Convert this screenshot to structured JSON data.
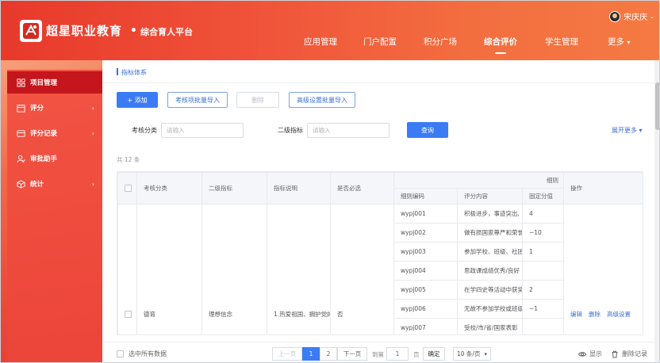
{
  "header": {
    "logo_text": "超星职业教育",
    "separator": "•",
    "platform_name": "综合育人平台",
    "user_name": "宋庆庆",
    "nav": [
      {
        "label": "应用管理",
        "active": false
      },
      {
        "label": "门户配置",
        "active": false
      },
      {
        "label": "积分广场",
        "active": false
      },
      {
        "label": "综合评价",
        "active": true
      },
      {
        "label": "学生管理",
        "active": false
      },
      {
        "label": "更多",
        "active": false
      }
    ]
  },
  "sidebar": {
    "items": [
      {
        "label": "项目管理",
        "icon": "grid-icon",
        "active": true,
        "arrow": ""
      },
      {
        "label": "评分",
        "icon": "calendar-icon",
        "active": false,
        "arrow": "›"
      },
      {
        "label": "评分记录",
        "icon": "card-icon",
        "active": false,
        "arrow": "›"
      },
      {
        "label": "审批助手",
        "icon": "user-check-icon",
        "active": false,
        "arrow": ""
      },
      {
        "label": "统计",
        "icon": "cube-icon",
        "active": false,
        "arrow": "›"
      }
    ]
  },
  "main": {
    "breadcrumb": "指标体系",
    "toolbar": {
      "add": "+ 添加",
      "batch_import": "考核项批量导入",
      "delete": "删除",
      "advanced_import": "高级设置批量导入"
    },
    "filters": {
      "category_label": "考核分类",
      "category_placeholder": "请输入",
      "level2_label": "二级指标",
      "level2_placeholder": "请输入",
      "query": "查询",
      "expand": "展开更多"
    },
    "total": "共 12 条",
    "table": {
      "headers": {
        "category": "考核分类",
        "level2": "二级指标",
        "description": "指标说明",
        "required": "是否必选",
        "rules": "细则",
        "rule_code": "细则编码",
        "score_content": "评分内容",
        "fixed_score": "固定分值",
        "actions": "操作"
      },
      "row": {
        "category": "德育",
        "level2": "理想信念",
        "description": "1.热爱祖国、拥护党的",
        "required": "否",
        "actions": {
          "edit": "编辑",
          "delete": "删除",
          "advanced": "高级设置"
        }
      },
      "rules": [
        {
          "code": "wypj001",
          "content": "积极进步，事迹突出,",
          "score": "4"
        },
        {
          "code": "wypj002",
          "content": "做有损国家尊严和荣誉",
          "score": "−10"
        },
        {
          "code": "wypj003",
          "content": "参加学校、班级、社团",
          "score": "1"
        },
        {
          "code": "wypj004",
          "content": "思政课成绩优秀/良好",
          "score": ""
        },
        {
          "code": "wypj005",
          "content": "在学四史等活动中获奖",
          "score": "2"
        },
        {
          "code": "wypj006",
          "content": "无故不参加学校或班级",
          "score": "−1"
        },
        {
          "code": "wypj007",
          "content": "受校/市/省/国家表彰",
          "score": ""
        }
      ]
    },
    "bottom": {
      "select_all": "选中所有数据",
      "prev": "上一页",
      "pages": [
        "1",
        "2"
      ],
      "next": "下一页",
      "goto_label": "到第",
      "goto_value": "1",
      "page_unit": "页",
      "confirm": "确定",
      "page_size": "10 条/页",
      "show": "显示",
      "deleted_records": "删除记录"
    }
  },
  "colors": {
    "brand_red": "#e8392b",
    "accent_blue": "#3b7cf5",
    "sidebar_active": "#c4161c"
  }
}
